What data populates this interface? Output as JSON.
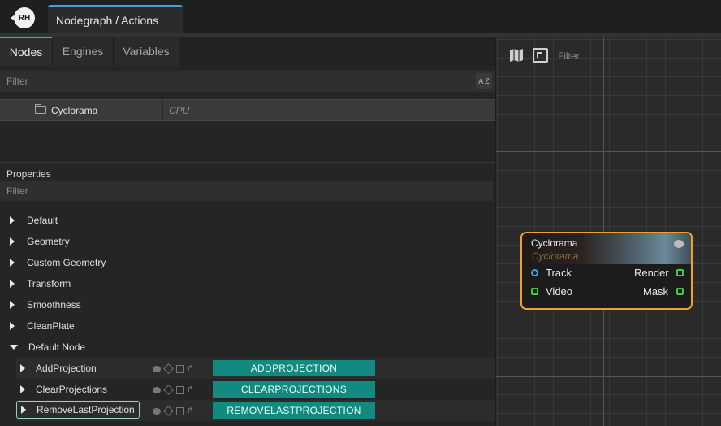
{
  "app": {
    "logo_text": "RH",
    "window_tab": "Nodegraph / Actions"
  },
  "left_tabs": [
    "Nodes",
    "Engines",
    "Variables"
  ],
  "nodes_filter_placeholder": "Filter",
  "sort_label": "A Z",
  "node_list": [
    {
      "name": "Cyclorama",
      "type": "CPU",
      "icon": "folder-icon"
    }
  ],
  "properties": {
    "title": "Properties",
    "filter_placeholder": "Filter",
    "groups": [
      "Default",
      "Geometry",
      "Custom Geometry",
      "Transform",
      "Smoothness",
      "CleanPlate",
      "Default Node"
    ],
    "expanded_group": "Default Node",
    "actions": [
      {
        "label": "AddProjection",
        "button": "ADDPROJECTION"
      },
      {
        "label": "ClearProjections",
        "button": "CLEARPROJECTIONS"
      },
      {
        "label": "RemoveLastProjection",
        "button": "REMOVELASTPROJECTION",
        "selected": true
      }
    ]
  },
  "graph": {
    "filter_placeholder": "Filter",
    "node": {
      "title": "Cyclorama",
      "subtitle": "Cyclorama",
      "inputs": [
        "Track",
        "Video"
      ],
      "outputs": [
        "Render",
        "Mask"
      ],
      "border_color": "#f0a030"
    }
  },
  "colors": {
    "accent": "#4a9fd8",
    "action_button": "#138a80",
    "port_green": "#48c848"
  }
}
